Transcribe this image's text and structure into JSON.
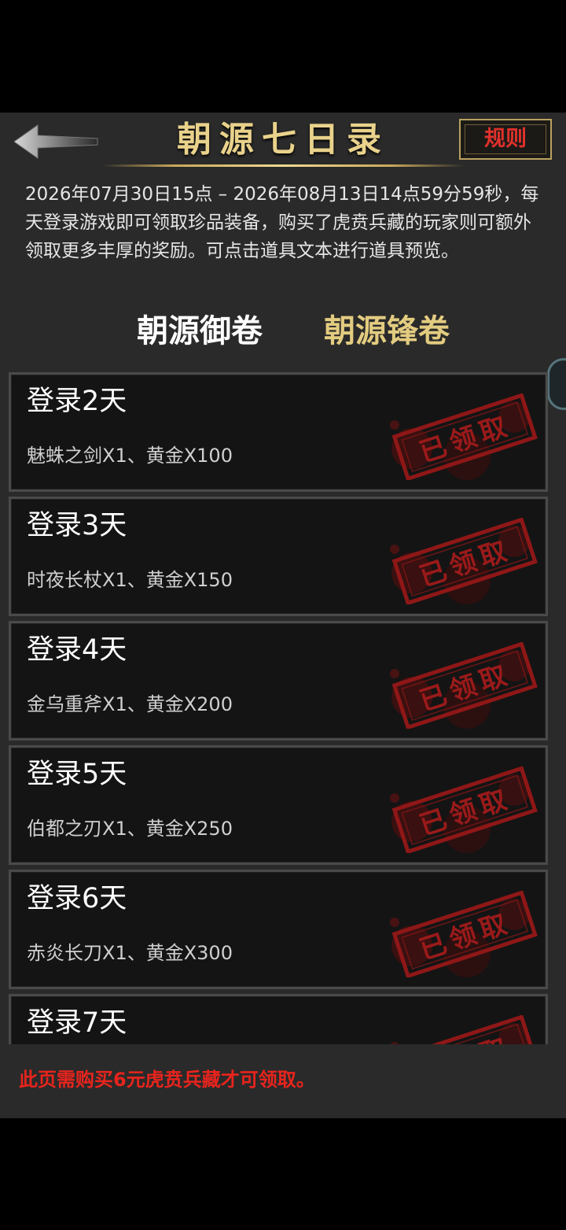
{
  "header": {
    "title": "朝源七日录",
    "rules_label": "规则"
  },
  "description": "2026年07月30日15点 – 2026年08月13日14点59分59秒，每天登录游戏即可领取珍品装备，购买了虎贲兵藏的玩家则可额外领取更多丰厚的奖励。可点击道具文本进行道具预览。",
  "tabs": [
    {
      "label": "朝源御卷",
      "active": true
    },
    {
      "label": "朝源锋卷",
      "active": false
    }
  ],
  "stamp_text": "已领取",
  "days": [
    {
      "title": "登录2天",
      "rewards": "魅蛛之剑X1、黄金X100",
      "claimed": true
    },
    {
      "title": "登录3天",
      "rewards": "时夜长杖X1、黄金X150",
      "claimed": true
    },
    {
      "title": "登录4天",
      "rewards": "金乌重斧X1、黄金X200",
      "claimed": true
    },
    {
      "title": "登录5天",
      "rewards": "伯都之刃X1、黄金X250",
      "claimed": true
    },
    {
      "title": "登录6天",
      "rewards": "赤炎长刀X1、黄金X300",
      "claimed": true
    },
    {
      "title": "登录7天",
      "rewards": "",
      "claimed": true
    }
  ],
  "notice": "此页需购买6元虎贲兵藏才可领取。",
  "colors": {
    "title_gold": "#e9d28b",
    "tab_active": "#ffffff",
    "tab_inactive": "#e3cc80",
    "notice_red": "#e8241d",
    "stamp_red": "#8f1717"
  }
}
